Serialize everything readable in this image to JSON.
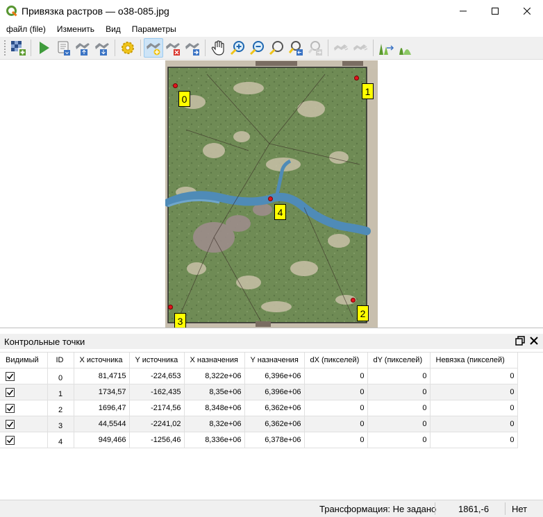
{
  "window": {
    "title": "Привязка растров — o38-085.jpg"
  },
  "menu": {
    "items": [
      "файл (file)",
      "Изменить",
      "Вид",
      "Параметры"
    ]
  },
  "toolbar": {
    "icons": [
      "open-raster-icon",
      "start-georeferencing-icon",
      "generate-gdal-script-icon",
      "load-gcp-icon",
      "save-gcp-icon",
      "transformation-settings-icon",
      "add-point-icon",
      "delete-point-icon",
      "move-point-icon",
      "pan-icon",
      "zoom-in-icon",
      "zoom-out-icon",
      "zoom-to-layer-icon",
      "zoom-last-icon",
      "zoom-next-icon",
      "link-georef-to-qgis-icon",
      "link-qgis-to-georef-icon",
      "full-histogram-stretch-icon",
      "local-histogram-stretch-icon"
    ]
  },
  "map": {
    "points": [
      {
        "label": "0"
      },
      {
        "label": "1"
      },
      {
        "label": "2"
      },
      {
        "label": "3"
      },
      {
        "label": "4"
      }
    ]
  },
  "gcp_panel": {
    "title": "Контрольные точки",
    "columns": [
      "Видимый",
      "ID",
      "X источника",
      "Y источника",
      "X назначения",
      "Y назначения",
      "dX (пикселей)",
      "dY (пикселей)",
      "Невязка (пикселей)"
    ],
    "rows": [
      {
        "visible": true,
        "id": "0",
        "src_x": "81,4715",
        "src_y": "-224,653",
        "dst_x": "8,322e+06",
        "dst_y": "6,396e+06",
        "dx": "0",
        "dy": "0",
        "residual": "0"
      },
      {
        "visible": true,
        "id": "1",
        "src_x": "1734,57",
        "src_y": "-162,435",
        "dst_x": "8,35e+06",
        "dst_y": "6,396e+06",
        "dx": "0",
        "dy": "0",
        "residual": "0"
      },
      {
        "visible": true,
        "id": "2",
        "src_x": "1696,47",
        "src_y": "-2174,56",
        "dst_x": "8,348e+06",
        "dst_y": "6,362e+06",
        "dx": "0",
        "dy": "0",
        "residual": "0"
      },
      {
        "visible": true,
        "id": "3",
        "src_x": "44,5544",
        "src_y": "-2241,02",
        "dst_x": "8,32e+06",
        "dst_y": "6,362e+06",
        "dx": "0",
        "dy": "0",
        "residual": "0"
      },
      {
        "visible": true,
        "id": "4",
        "src_x": "949,466",
        "src_y": "-1256,46",
        "dst_x": "8,336e+06",
        "dst_y": "6,378e+06",
        "dx": "0",
        "dy": "0",
        "residual": "0"
      }
    ]
  },
  "status": {
    "transformation": "Трансформация: Не задано",
    "coordinates": "1861,-6",
    "crs": "Нет"
  },
  "colors": {
    "accent": "#2d7bd6",
    "gcp_point": "#e0141e",
    "gcp_label": "#ffff00",
    "river": "#4f8bb7",
    "map_green": "#6f8b55"
  }
}
